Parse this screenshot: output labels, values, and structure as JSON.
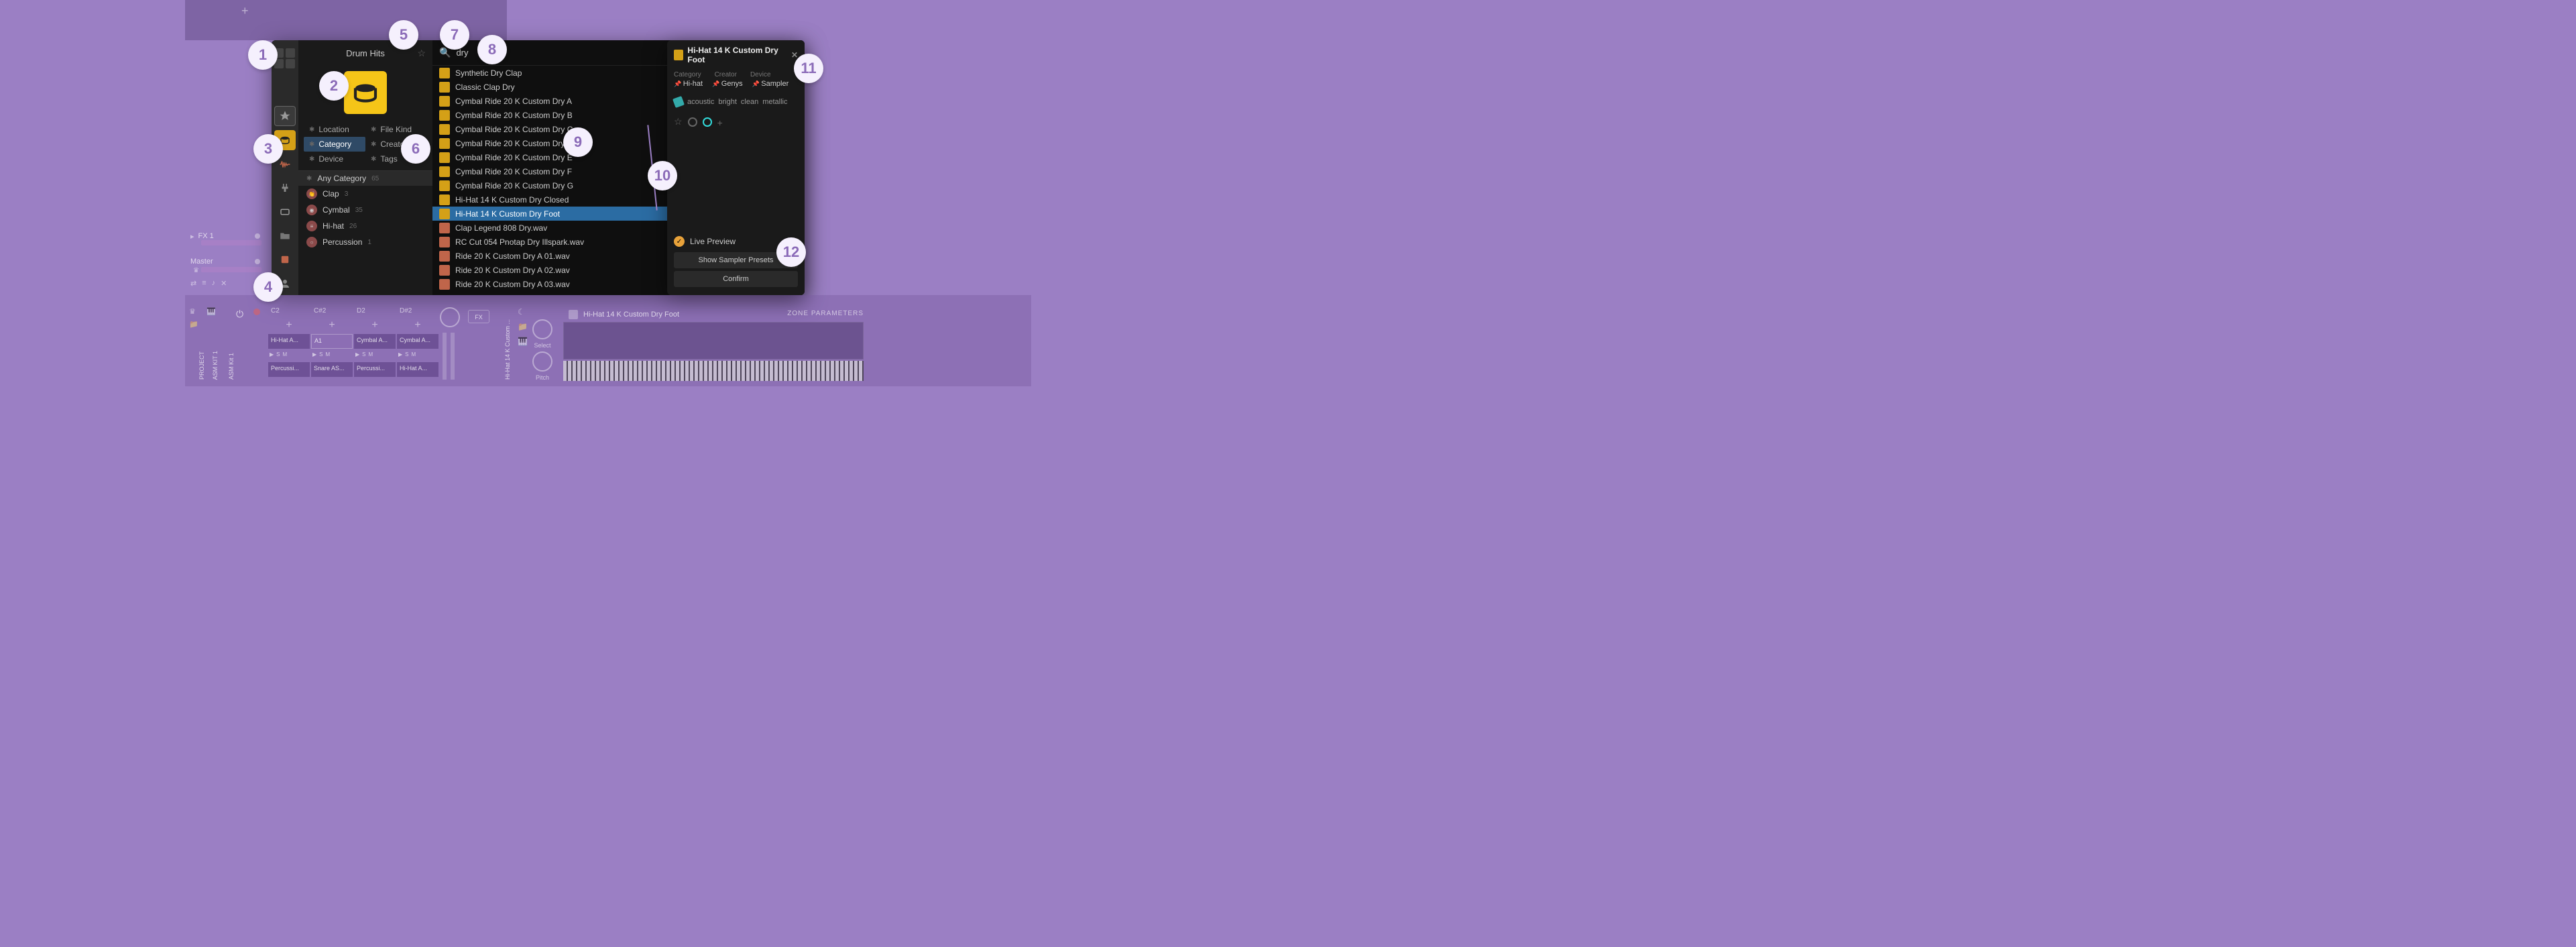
{
  "callouts": [
    "1",
    "2",
    "3",
    "4",
    "5",
    "6",
    "7",
    "8",
    "9",
    "10",
    "11",
    "12"
  ],
  "tracks": {
    "fx1": "FX 1",
    "master": "Master"
  },
  "browser": {
    "title": "Drum Hits",
    "filters": [
      {
        "label": "Location"
      },
      {
        "label": "File Kind"
      },
      {
        "label": "Category",
        "selected": true
      },
      {
        "label": "Creator"
      },
      {
        "label": "Device"
      },
      {
        "label": "Tags"
      }
    ],
    "categories": [
      {
        "label": "Any Category",
        "count": "65",
        "any": true
      },
      {
        "label": "Clap",
        "count": "3"
      },
      {
        "label": "Cymbal",
        "count": "35"
      },
      {
        "label": "Hi-hat",
        "count": "26"
      },
      {
        "label": "Percussion",
        "count": "1"
      }
    ],
    "search": {
      "value": "dry"
    },
    "results": [
      {
        "name": "Synthetic Dry Clap",
        "icon": "yellow"
      },
      {
        "name": "Classic Clap Dry",
        "icon": "yellow",
        "rating": "★●"
      },
      {
        "name": "Cymbal Ride 20 K Custom Dry A",
        "icon": "yellow"
      },
      {
        "name": "Cymbal Ride 20 K Custom Dry B",
        "icon": "yellow"
      },
      {
        "name": "Cymbal Ride 20 K Custom Dry C",
        "icon": "yellow"
      },
      {
        "name": "Cymbal Ride 20 K Custom Dry D",
        "icon": "yellow"
      },
      {
        "name": "Cymbal Ride 20 K Custom Dry E",
        "icon": "yellow"
      },
      {
        "name": "Cymbal Ride 20 K Custom Dry F",
        "icon": "yellow"
      },
      {
        "name": "Cymbal Ride 20 K Custom Dry G",
        "icon": "yellow"
      },
      {
        "name": "Hi-Hat 14 K Custom Dry Closed",
        "icon": "yellow"
      },
      {
        "name": "Hi-Hat 14 K Custom Dry Foot",
        "icon": "yellow",
        "selected": true,
        "dot": "cyan"
      },
      {
        "name": "Clap Legend 808 Dry.wav",
        "icon": "orange",
        "rating": "★"
      },
      {
        "name": "RC Cut 054 Pnotap Dry Illspark.wav",
        "icon": "orange"
      },
      {
        "name": "Ride 20 K Custom Dry A 01.wav",
        "icon": "orange",
        "dot": "grey"
      },
      {
        "name": "Ride 20 K Custom Dry A 02.wav",
        "icon": "orange"
      },
      {
        "name": "Ride 20 K Custom Dry A 03.wav",
        "icon": "orange"
      }
    ]
  },
  "details": {
    "title": "Hi-Hat 14 K Custom Dry Foot",
    "meta_labels": {
      "category": "Category",
      "creator": "Creator",
      "device": "Device"
    },
    "meta_values": {
      "category": "Hi-hat",
      "creator": "Genys",
      "device": "Sampler"
    },
    "tags": [
      "acoustic",
      "bright",
      "clean",
      "metallic"
    ],
    "live_preview": "Live Preview",
    "btn_presets": "Show Sampler Presets",
    "btn_confirm": "Confirm"
  },
  "pads": {
    "cols": [
      {
        "hdr": "C2",
        "cell1": "Hi-Hat A...",
        "cell2": "Percussi..."
      },
      {
        "hdr": "C#2",
        "cell1": "A1",
        "cell2": "Snare AS...",
        "active1": true
      },
      {
        "hdr": "D2",
        "cell1": "Cymbal A...",
        "cell2": "Percussi..."
      },
      {
        "hdr": "D#2",
        "cell1": "Cymbal A...",
        "cell2": "Hi-Hat A..."
      }
    ],
    "ctl": [
      "▶",
      "S",
      "M"
    ]
  },
  "zone": {
    "title": "Hi-Hat 14 K Custom Dry Foot",
    "params_label": "ZONE PARAMETERS",
    "knob1": "Select",
    "knob2": "Pitch"
  },
  "bottom": {
    "fx": "FX"
  },
  "vtext": {
    "project": "PROJECT",
    "kit1": "ASM KIT 1",
    "kit2": "ASM Kit 1",
    "sample": "Hi-Hat 14 K Custom ..."
  }
}
